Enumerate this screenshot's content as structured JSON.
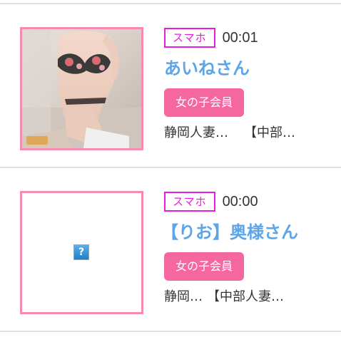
{
  "listings": [
    {
      "device_badge": "スマホ",
      "time": "00:01",
      "name": "あいねさん",
      "member_badge": "女の子会員",
      "area_1": "静岡人妻…",
      "area_2": "【中部…",
      "photo": "photo"
    },
    {
      "device_badge": "スマホ",
      "time": "00:00",
      "name": "【りお】奥様さん",
      "member_badge": "女の子会員",
      "area_1": "静岡…",
      "area_2": "【中部人妻…",
      "photo": "broken-image-icon"
    }
  ],
  "colors": {
    "thumb_border": "#f58cb0",
    "device_badge": "#e81be0",
    "name": "#5ea5e8",
    "member_badge": "#f4689f"
  }
}
